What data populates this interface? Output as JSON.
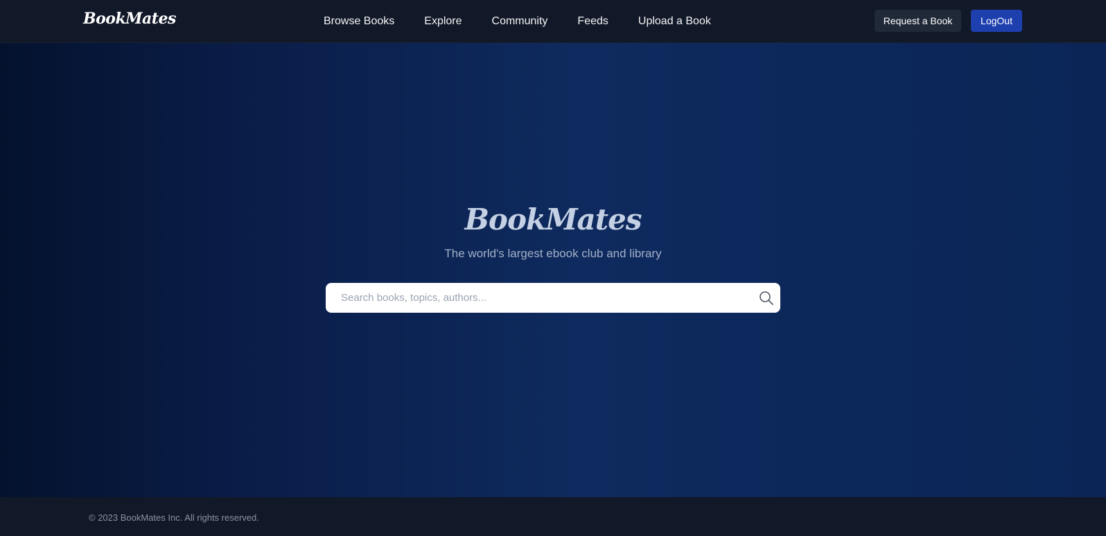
{
  "navbar": {
    "brand": "BookMates",
    "links": [
      "Browse Books",
      "Explore",
      "Community",
      "Feeds",
      "Upload a Book"
    ],
    "request_button": "Request a Book",
    "logout_button": "LogOut"
  },
  "hero": {
    "title": "BookMates",
    "subtitle": "The world's largest ebook club and library",
    "search": {
      "placeholder": "Search books, topics, authors...",
      "value": "",
      "icon": "search-icon"
    }
  },
  "footer": {
    "copyright": "© 2023 BookMates Inc. All rights reserved."
  },
  "colors": {
    "navbar_bg": "#111827",
    "logout_bg": "#1e40af",
    "request_bg": "#1f2937",
    "hero_bg_dark": "#04122e",
    "hero_bg_mid": "#0e2a5e",
    "hero_title": "#c4d0e4"
  }
}
